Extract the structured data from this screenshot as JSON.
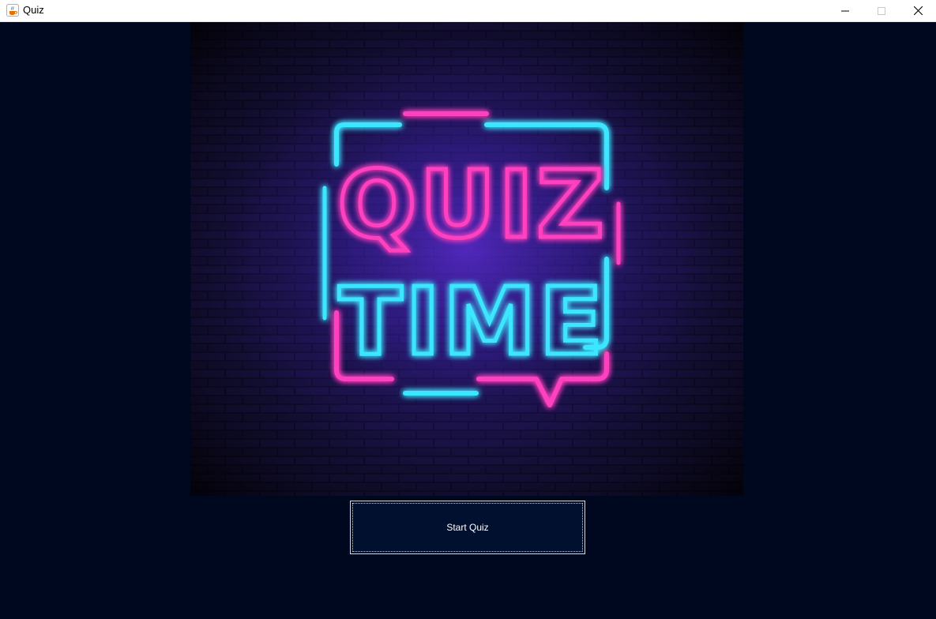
{
  "window": {
    "title": "Quiz",
    "icon": "java-cup-icon",
    "controls": [
      "minimize-icon",
      "maximize-icon",
      "close-icon"
    ]
  },
  "hero": {
    "line1": "QUIZ",
    "line2": "TIME",
    "colors": {
      "pink": "#ff3fbf",
      "cyan": "#3ee6ff",
      "background": "#000820",
      "brick": "#1a1447"
    }
  },
  "start_button": {
    "label": "Start Quiz"
  }
}
